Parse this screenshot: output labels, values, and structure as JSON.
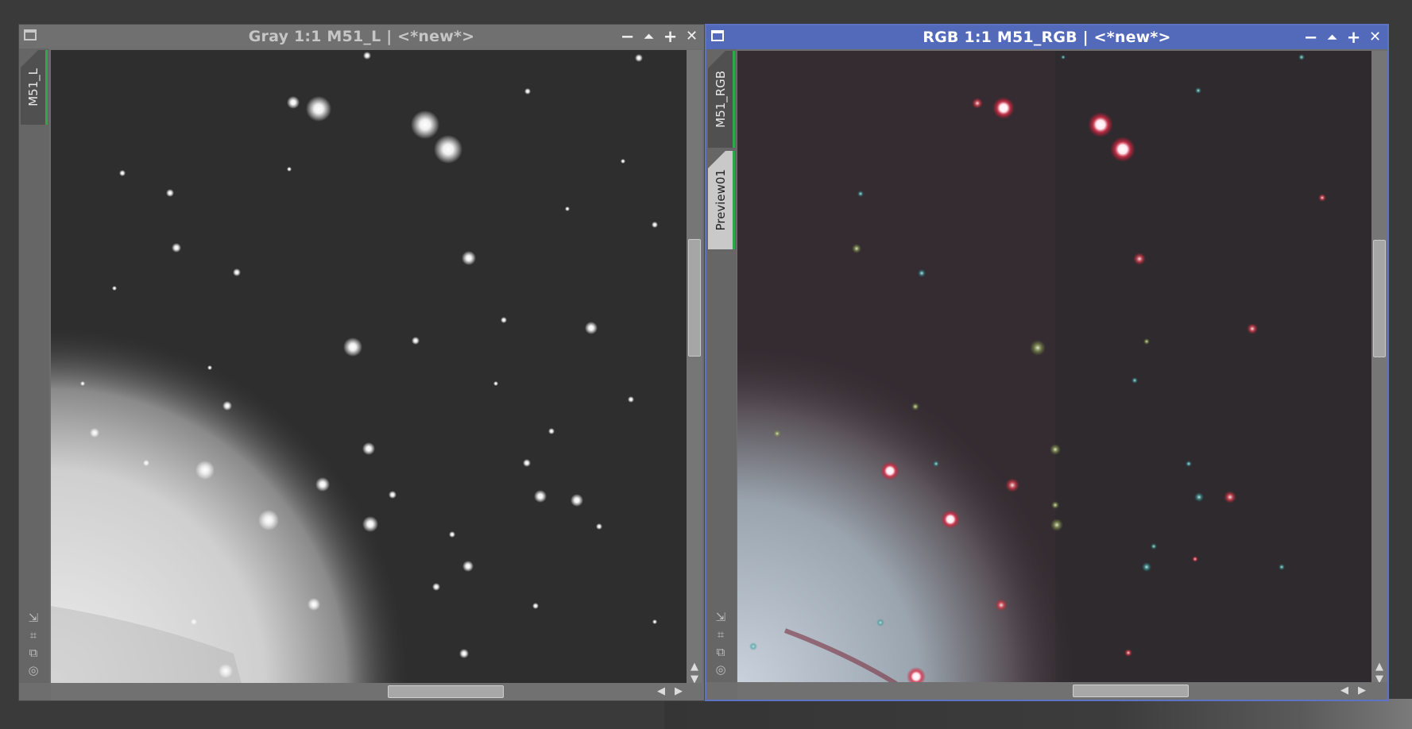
{
  "left_window": {
    "title": "Gray 1:1 M51_L | <*new*>",
    "tabs": [
      {
        "label": "M51_L",
        "active": true
      }
    ],
    "controls": [
      "minimize-icon",
      "shade-icon",
      "maximize-icon",
      "close-icon"
    ]
  },
  "right_window": {
    "title": "RGB 1:1 M51_RGB | <*new*>",
    "tabs": [
      {
        "label": "M51_RGB",
        "active": true
      },
      {
        "label": "Preview01",
        "active": false
      }
    ],
    "controls": [
      "minimize-icon",
      "shade-icon",
      "maximize-icon",
      "close-icon"
    ]
  },
  "glyphs": {
    "minimize": "−",
    "shade": "⏶",
    "maximize": "+",
    "close": "✕",
    "fit": "⇲",
    "zoom": "⌗",
    "clone": "⧉",
    "target": "◎",
    "up": "▲",
    "down": "▼",
    "left": "◀",
    "right": "▶"
  },
  "colors": {
    "active_titlebar": "#5369ba",
    "inactive_titlebar": "#707070",
    "tab_indicator": "#2ea84a"
  }
}
